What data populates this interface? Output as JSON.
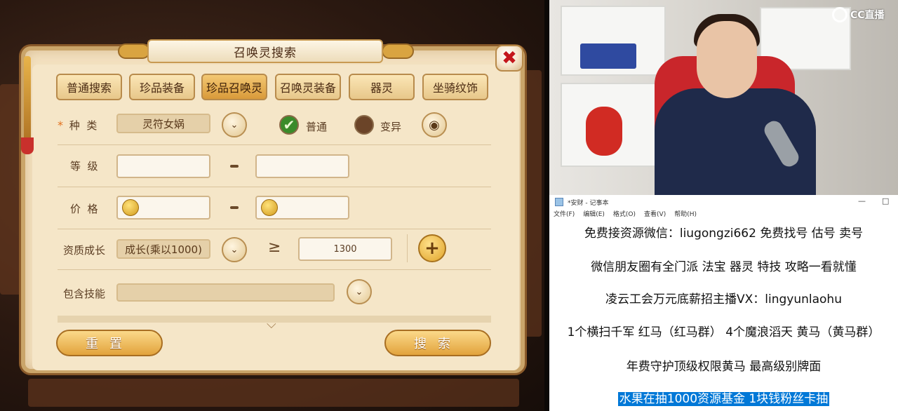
{
  "panel": {
    "title": "召唤灵搜索",
    "close_icon": "✖",
    "tabs": [
      "普通搜索",
      "珍品装备",
      "珍品召唤灵",
      "召唤灵装备",
      "器灵",
      "坐骑纹饰"
    ],
    "active_tab": "珍品召唤灵",
    "kind_label": "种  类",
    "kind_required": "*",
    "kind_value": "灵符女娲",
    "radio_normal_label": "普通",
    "radio_variant_label": "变异",
    "level_label": "等  级",
    "price_label": "价  格",
    "growth_label": "资质成长",
    "growth_value": "成长(乘以1000)",
    "growth_op": "≥",
    "growth_min": "1300",
    "skills_label": "包含技能",
    "reset_label": "重置",
    "search_label": "搜索"
  },
  "stream": {
    "logo_text": "CC直播"
  },
  "notepad": {
    "title": "*安财 - 记事本",
    "menu": [
      "文件(F)",
      "编辑(E)",
      "格式(O)",
      "查看(V)",
      "帮助(H)"
    ],
    "lines": [
      "免费接资源微信：liugongzi662  免费找号 估号 卖号",
      "微信朋友圈有全门派 法宝 器灵 特技 攻略一看就懂",
      "凌云工会万元底薪招主播VX：lingyunlaohu",
      "1个横扫千军 红马（红马群） 4个魔浪滔天 黄马（黄马群）",
      "年费守护顶级权限黄马 最高级别牌面",
      "水果在抽1000资源基金 1块钱粉丝卡抽"
    ]
  }
}
